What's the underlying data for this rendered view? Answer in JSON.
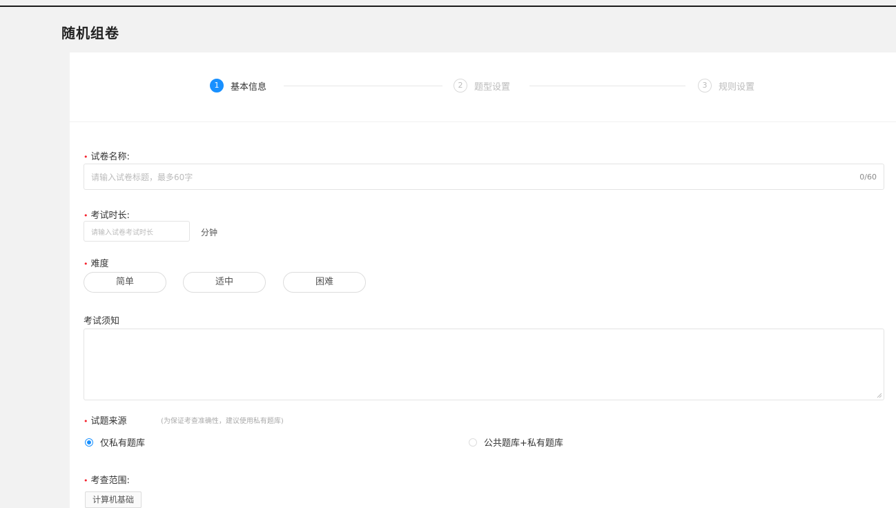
{
  "page": {
    "title": "随机组卷"
  },
  "steps": [
    {
      "number": "1",
      "label": "基本信息",
      "status": "active"
    },
    {
      "number": "2",
      "label": "题型设置",
      "status": "idle"
    },
    {
      "number": "3",
      "label": "规则设置",
      "status": "idle"
    }
  ],
  "form": {
    "name": {
      "label": "试卷名称:",
      "placeholder": "请输入试卷标题，最多60字",
      "counter": "0/60"
    },
    "duration": {
      "label": "考试时长:",
      "placeholder": "请输入试卷考试时长",
      "unit": "分钟"
    },
    "difficulty": {
      "label": "难度",
      "options": [
        "简单",
        "适中",
        "困难"
      ]
    },
    "notice": {
      "label": "考试须知"
    },
    "source": {
      "label": "试题来源",
      "hint": "(为保证考查准确性，建议使用私有题库)",
      "options": [
        {
          "label": "仅私有题库",
          "selected": true
        },
        {
          "label": "公共题库+私有题库",
          "selected": false
        }
      ]
    },
    "scope": {
      "label": "考查范围:",
      "tags": [
        "计算机基础"
      ]
    }
  },
  "colors": {
    "accent": "#1890ff",
    "required": "#f5222d"
  }
}
